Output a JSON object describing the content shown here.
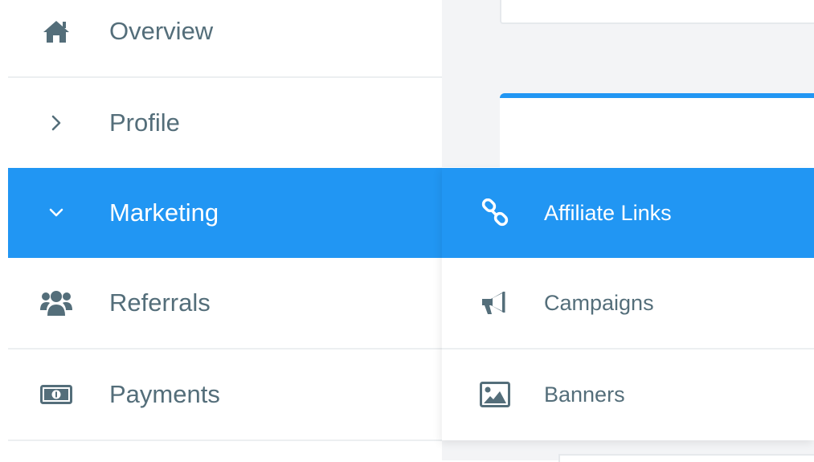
{
  "colors": {
    "accent": "#2196f3",
    "text": "#546e7a",
    "active_text": "#ffffff"
  },
  "sidebar": {
    "items": [
      {
        "label": "Overview",
        "icon": "home-icon"
      },
      {
        "label": "Profile",
        "icon": "chevron-right-icon"
      },
      {
        "label": "Marketing",
        "icon": "chevron-down-icon",
        "active": true
      },
      {
        "label": "Referrals",
        "icon": "users-icon"
      },
      {
        "label": "Payments",
        "icon": "money-bill-icon"
      }
    ]
  },
  "submenu": {
    "items": [
      {
        "label": "Affiliate Links",
        "icon": "link-icon",
        "active": true
      },
      {
        "label": "Campaigns",
        "icon": "bullhorn-icon"
      },
      {
        "label": "Banners",
        "icon": "image-icon"
      }
    ]
  }
}
